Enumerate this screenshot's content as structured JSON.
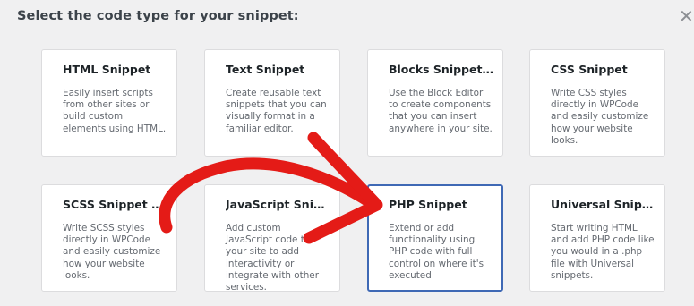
{
  "dialog": {
    "title": "Select the code type for your snippet:",
    "close_glyph": "✕"
  },
  "cards": [
    {
      "title": "HTML Snippet",
      "description": "Easily insert scripts from other sites or build custom elements using HTML."
    },
    {
      "title": "Text Snippet",
      "description": "Create reusable text snippets that you can visually format in a familiar editor."
    },
    {
      "title": "Blocks Snippet (P...",
      "description": "Use the Block Editor to create components that you can insert anywhere in your site."
    },
    {
      "title": "CSS Snippet",
      "description": "Write CSS styles directly in WPCode and easily customize how your website looks."
    },
    {
      "title": "SCSS Snippet (PRO)",
      "description": "Write SCSS styles directly in WPCode and easily customize how your website looks."
    },
    {
      "title": "JavaScript Snippet",
      "description": "Add custom JavaScript code to your site to add interactivity or integrate with other services."
    },
    {
      "title": "PHP Snippet",
      "description": "Extend or add functionality using PHP code with full control on where it's executed"
    },
    {
      "title": "Universal Snippet",
      "description": "Start writing HTML and add PHP code like you would in a .php file with Universal snippets."
    }
  ],
  "colors": {
    "arrow": "#e41b17",
    "selected_border": "#3f69b5"
  },
  "icons": [
    "close-icon",
    "annotation-arrow"
  ]
}
